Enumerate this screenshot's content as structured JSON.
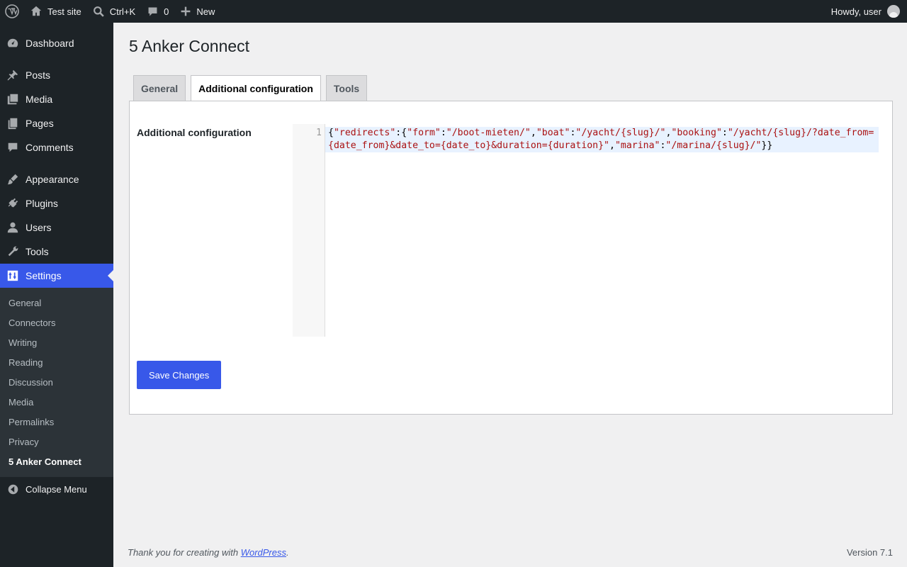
{
  "adminbar": {
    "site_name": "Test site",
    "search_shortcut": "Ctrl+K",
    "comments_count": "0",
    "new_label": "New",
    "greeting": "Howdy, user"
  },
  "sidebar": {
    "items": [
      {
        "label": "Dashboard",
        "icon": "dashboard-icon"
      },
      {
        "label": "Posts",
        "icon": "pin-icon"
      },
      {
        "label": "Media",
        "icon": "media-icon"
      },
      {
        "label": "Pages",
        "icon": "pages-icon"
      },
      {
        "label": "Comments",
        "icon": "comment-icon"
      },
      {
        "label": "Appearance",
        "icon": "brush-icon"
      },
      {
        "label": "Plugins",
        "icon": "plug-icon"
      },
      {
        "label": "Users",
        "icon": "user-icon"
      },
      {
        "label": "Tools",
        "icon": "wrench-icon"
      },
      {
        "label": "Settings",
        "icon": "settings-icon"
      }
    ],
    "submenu": [
      "General",
      "Connectors",
      "Writing",
      "Reading",
      "Discussion",
      "Media",
      "Permalinks",
      "Privacy",
      "5 Anker Connect"
    ],
    "collapse_label": "Collapse Menu"
  },
  "page": {
    "title": "5 Anker Connect",
    "tabs": [
      "General",
      "Additional configuration",
      "Tools"
    ],
    "active_tab": "Additional configuration",
    "field_label": "Additional configuration",
    "line_number": "1",
    "code_value": "{\"redirects\":{\"form\":\"/boot-mieten/\",\"boat\":\"/yacht/{slug}/\",\"booking\":\"/yacht/{slug}/?date_from={date_from}&date_to={date_to}&duration={duration}\",\"marina\":\"/marina/{slug}/\"}}",
    "code_tokens": [
      {
        "t": "{",
        "k": "pun"
      },
      {
        "t": "\"redirects\"",
        "k": "str"
      },
      {
        "t": ":{",
        "k": "pun"
      },
      {
        "t": "\"form\"",
        "k": "str"
      },
      {
        "t": ":",
        "k": "pun"
      },
      {
        "t": "\"/boot-mieten/\"",
        "k": "str"
      },
      {
        "t": ",",
        "k": "pun"
      },
      {
        "t": "\"boat\"",
        "k": "str"
      },
      {
        "t": ":",
        "k": "pun"
      },
      {
        "t": "\"/yacht/{slug}/\"",
        "k": "str"
      },
      {
        "t": ",",
        "k": "pun"
      },
      {
        "t": "\"booking\"",
        "k": "str"
      },
      {
        "t": ":",
        "k": "pun"
      },
      {
        "t": "\"/yacht/{slug}/?date_from={date_from}&date_to={date_to}&duration={duration}\"",
        "k": "str"
      },
      {
        "t": ",",
        "k": "pun"
      },
      {
        "t": "\"marina\"",
        "k": "str"
      },
      {
        "t": ":",
        "k": "pun"
      },
      {
        "t": "\"/marina/{slug}/\"",
        "k": "str"
      },
      {
        "t": "}}",
        "k": "pun"
      }
    ],
    "save_label": "Save Changes"
  },
  "footer": {
    "thanks_prefix": "Thank you for creating with ",
    "thanks_link": "WordPress",
    "thanks_suffix": ".",
    "version": "Version 7.1"
  },
  "colors": {
    "accent": "#3858e9",
    "adminbar_bg": "#1d2327",
    "string_token": "#aa1111"
  }
}
